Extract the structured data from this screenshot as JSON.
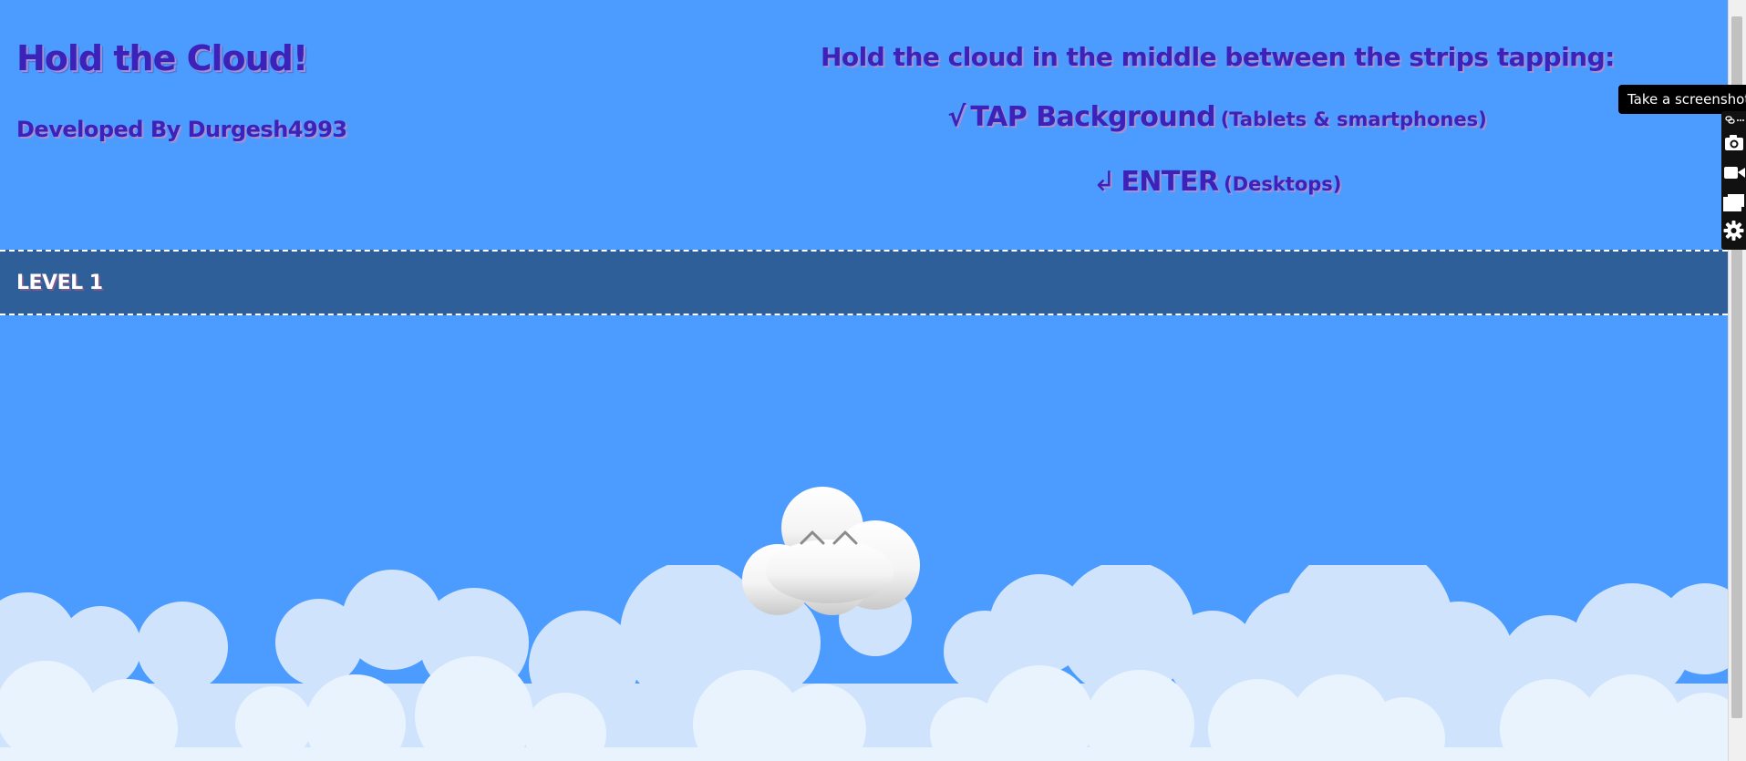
{
  "game": {
    "title": "Hold the Cloud!",
    "developer": "Developed By Durgesh4993",
    "instructions": {
      "heading": "Hold the cloud in the middle between the strips tapping:",
      "tap_symbol": "√",
      "tap_action": "TAP Background",
      "tap_devices": "(Tablets & smartphones)",
      "enter_symbol": "↲",
      "enter_action": "ENTER",
      "enter_devices": "(Desktops)"
    },
    "level_label": "LEVEL 1"
  },
  "screenshot_tool": {
    "tooltip": "Take a screenshot",
    "tools": [
      "link-icon",
      "camera-icon",
      "video-camera-icon",
      "windows-icon",
      "gear-icon"
    ]
  },
  "colors": {
    "sky": "#4c9cff",
    "strip": "#2e5f99",
    "title_text": "#3b22b8",
    "title_shadow": "#a78fd6"
  }
}
